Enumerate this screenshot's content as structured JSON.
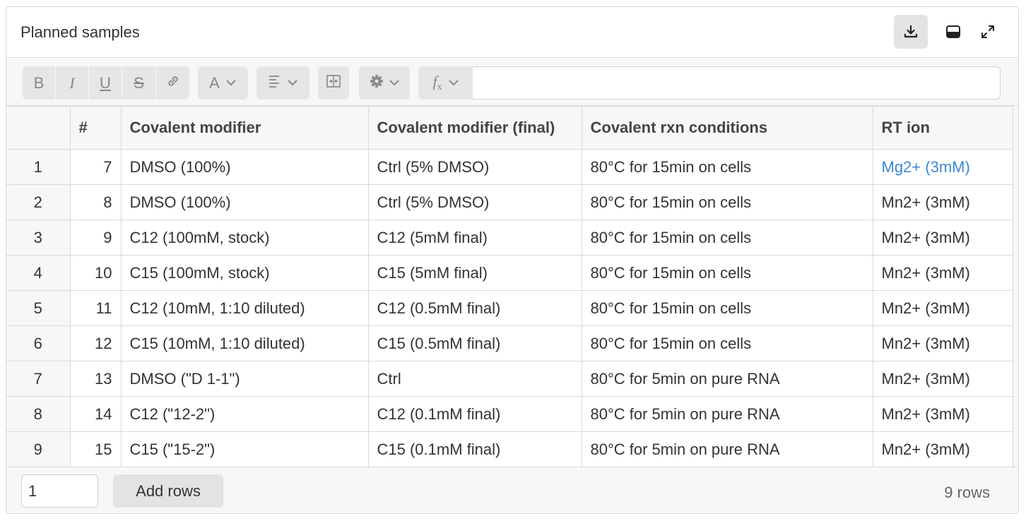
{
  "header": {
    "title": "Planned samples",
    "icons": [
      "download-icon",
      "panel-icon",
      "expand-icon"
    ]
  },
  "toolbar": {
    "buttons": [
      {
        "name": "bold",
        "glyph": "B"
      },
      {
        "name": "italic",
        "glyph": "I"
      },
      {
        "name": "underline",
        "glyph": "U"
      },
      {
        "name": "strikethrough",
        "glyph": "S"
      },
      {
        "name": "link",
        "glyph": "link-icon"
      },
      {
        "name": "text-color",
        "glyph": "A"
      },
      {
        "name": "align",
        "glyph": "align-left-icon"
      },
      {
        "name": "merge",
        "glyph": "merge-icon"
      },
      {
        "name": "settings",
        "glyph": "gear-icon"
      },
      {
        "name": "formula",
        "glyph": "fx"
      }
    ],
    "formula_value": ""
  },
  "table": {
    "columns": [
      "",
      "#",
      "Covalent modifier",
      "Covalent modifier (final)",
      "Covalent rxn conditions",
      "RT ion"
    ],
    "rows": [
      {
        "rn": "1",
        "num": "7",
        "modifier": "DMSO (100%)",
        "final": "Ctrl (5% DMSO)",
        "conditions": "80°C for 15min on cells",
        "ion": "Mg2+ (3mM)"
      },
      {
        "rn": "2",
        "num": "8",
        "modifier": "DMSO (100%)",
        "final": "Ctrl (5% DMSO)",
        "conditions": "80°C for 15min on cells",
        "ion": "Mn2+ (3mM)"
      },
      {
        "rn": "3",
        "num": "9",
        "modifier": "C12 (100mM, stock)",
        "final": "C12 (5mM final)",
        "conditions": "80°C for 15min on cells",
        "ion": "Mn2+ (3mM)"
      },
      {
        "rn": "4",
        "num": "10",
        "modifier": "C15 (100mM, stock)",
        "final": "C15 (5mM final)",
        "conditions": "80°C for 15min on cells",
        "ion": "Mn2+ (3mM)"
      },
      {
        "rn": "5",
        "num": "11",
        "modifier": "C12 (10mM, 1:10 diluted)",
        "final": "C12 (0.5mM final)",
        "conditions": "80°C for 15min on cells",
        "ion": "Mn2+ (3mM)"
      },
      {
        "rn": "6",
        "num": "12",
        "modifier": "C15 (10mM, 1:10 diluted)",
        "final": "C15 (0.5mM final)",
        "conditions": "80°C for 15min on cells",
        "ion": "Mn2+ (3mM)"
      },
      {
        "rn": "7",
        "num": "13",
        "modifier": "DMSO (\"D 1-1\")",
        "final": "Ctrl",
        "conditions": "80°C for 5min on pure RNA",
        "ion": "Mn2+ (3mM)"
      },
      {
        "rn": "8",
        "num": "14",
        "modifier": "C12 (\"12-2\")",
        "final": "C12 (0.1mM final)",
        "conditions": "80°C for 5min on pure RNA",
        "ion": "Mn2+ (3mM)"
      },
      {
        "rn": "9",
        "num": "15",
        "modifier": "C15 (\"15-2\")",
        "final": "C15 (0.1mM final)",
        "conditions": "80°C for 5min on pure RNA",
        "ion": "Mn2+ (3mM)"
      }
    ]
  },
  "footer": {
    "rows_input_value": "1",
    "add_rows_label": "Add rows",
    "row_count": "9 rows"
  },
  "colors": {
    "link": "#3d88d4",
    "toolbar_bg": "#f7f7f7",
    "button_bg": "#e6e6e6",
    "border": "#d9d9d9"
  }
}
